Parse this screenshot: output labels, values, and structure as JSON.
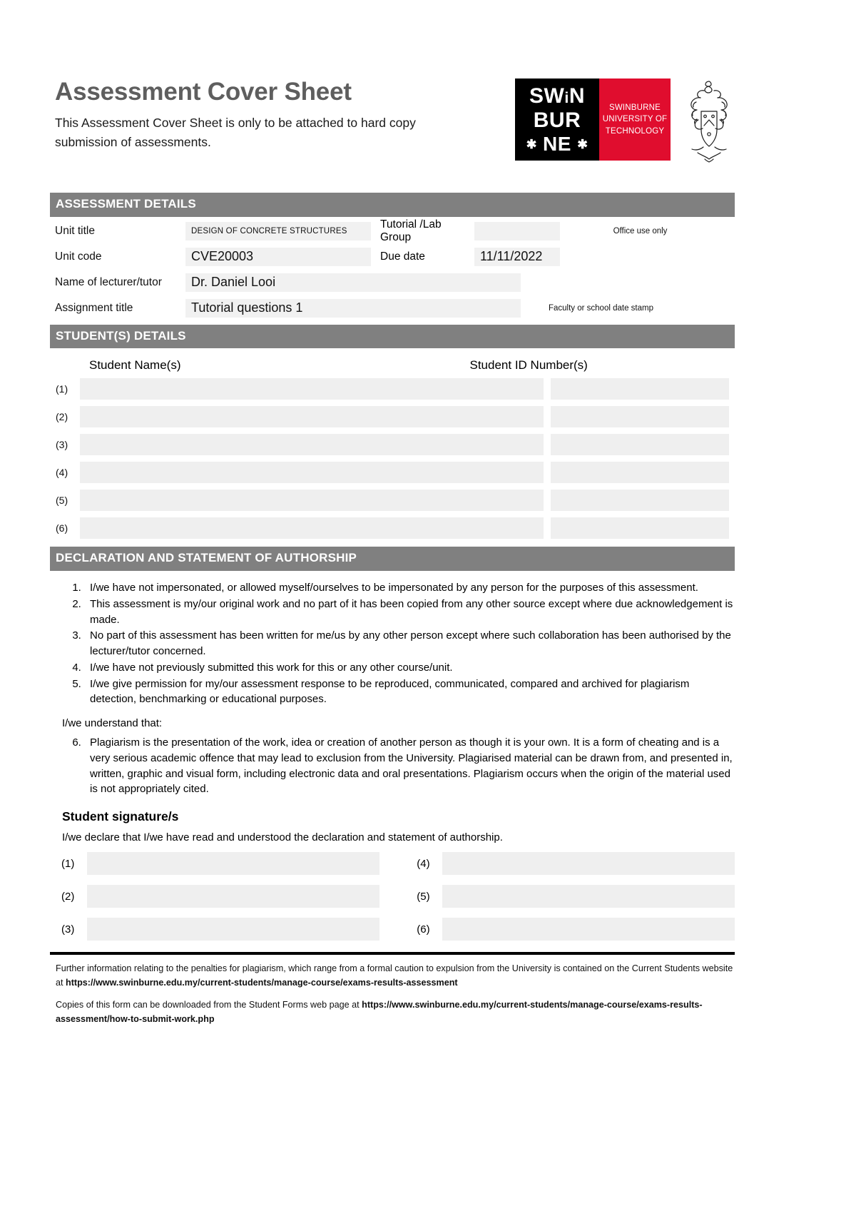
{
  "header": {
    "title": "Assessment Cover Sheet",
    "subtitle": "This Assessment Cover Sheet is only to be attached to hard copy submission of assessments.",
    "logo": {
      "line1": "SWiN",
      "line2": "BUR",
      "line3": "✱ NE ✱",
      "wordmark": "SWINBURNE UNIVERSITY OF TECHNOLOGY",
      "wordmark_line1": "SWINBURNE",
      "wordmark_line2": "UNIVERSITY OF",
      "wordmark_line3": "TECHNOLOGY",
      "black": "#000000",
      "red": "#e00d2e"
    }
  },
  "assessment": {
    "section_title": "ASSESSMENT DETAILS",
    "unit_title_label": "Unit title",
    "unit_title_value": "DESIGN OF CONCRETE STRUCTURES",
    "tutorial_label": "Tutorial /Lab Group",
    "tutorial_value": "",
    "office_use": "Office use only",
    "unit_code_label": "Unit code",
    "unit_code_value": "CVE20003",
    "due_date_label": "Due date",
    "due_date_value": "11/11/2022",
    "lecturer_label": "Name of lecturer/tutor",
    "lecturer_value": "Dr. Daniel Looi",
    "assignment_label": "Assignment title",
    "assignment_value": "Tutorial questions 1",
    "date_stamp_note": "Faculty or school date stamp"
  },
  "students": {
    "section_title": "STUDENT(S) DETAILS",
    "name_header": "Student Name(s)",
    "id_header": "Student ID Number(s)",
    "rows": [
      {
        "num": "(1)",
        "name": "",
        "id": ""
      },
      {
        "num": "(2)",
        "name": "",
        "id": ""
      },
      {
        "num": "(3)",
        "name": "",
        "id": ""
      },
      {
        "num": "(4)",
        "name": "",
        "id": ""
      },
      {
        "num": "(5)",
        "name": "",
        "id": ""
      },
      {
        "num": "(6)",
        "name": "",
        "id": ""
      }
    ]
  },
  "declaration": {
    "section_title": "DECLARATION AND STATEMENT OF AUTHORSHIP",
    "items": [
      "I/we have not impersonated, or allowed myself/ourselves to be impersonated by any person for the purposes of this assessment.",
      "This assessment is my/our original work and no part of it has been copied from any other source except where due acknowledgement is made.",
      "No part of this assessment has been written for me/us by any other person except where such collaboration has been authorised by the lecturer/tutor concerned.",
      "I/we have not previously submitted this work for this or any other course/unit.",
      "I/we  give permission for my/our assessment response to be reproduced, communicated, compared and archived for plagiarism detection, benchmarking or educational purposes."
    ],
    "understand_intro": "I/we understand that:",
    "item6": "Plagiarism is the presentation of the work, idea or creation of another person as though it is your own. It is a form of cheating and is a very serious academic offence that may lead to exclusion from the University. Plagiarised material can be drawn from, and presented in, written, graphic and visual form, including electronic data and oral presentations. Plagiarism occurs when the origin of the material used is not appropriately cited."
  },
  "signature": {
    "title": "Student signature/s",
    "subtitle": "I/we declare that I/we have read and understood the declaration and statement of authorship.",
    "left_rows": [
      {
        "num": "(1)",
        "value": ""
      },
      {
        "num": "(2)",
        "value": ""
      },
      {
        "num": "(3)",
        "value": ""
      }
    ],
    "right_rows": [
      {
        "num": "(4)",
        "value": ""
      },
      {
        "num": "(5)",
        "value": ""
      },
      {
        "num": "(6)",
        "value": ""
      }
    ]
  },
  "footer": {
    "p1_pre": "Further information relating to the penalties for plagiarism, which range from a formal caution to expulsion from the University is contained on the Current Students website at ",
    "p1_url": "https://www.swinburne.edu.my/current-students/manage-course/exams-results-assessment",
    "p2_pre": "Copies of this form can be downloaded from the Student Forms web page at ",
    "p2_url": "https://www.swinburne.edu.my/current-students/manage-course/exams-results-assessment/how-to-submit-work.php"
  }
}
